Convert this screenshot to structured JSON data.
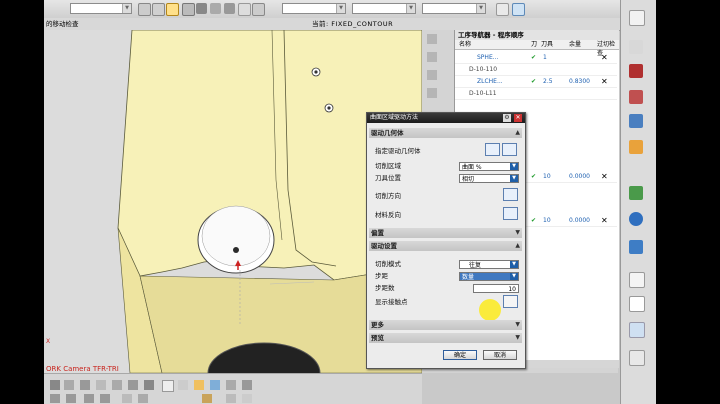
{
  "toolbar": {
    "combo1": "",
    "combo2": "",
    "combo3": "",
    "combo4": "",
    "mode_text": "当前: FIXED_CONTOUR",
    "left_title": "的移动检查"
  },
  "viewport": {
    "camera_label": "ORK Camera TFR-TRI",
    "axis_mark": "X"
  },
  "nav": {
    "title": "工序导航器 - 程序顺序",
    "columns": [
      "名称",
      "刀",
      "刀具",
      "余量",
      "过切检查"
    ],
    "rows": [
      {
        "name": "SPHE...",
        "tool": "1",
        "stock": ""
      },
      {
        "name": "D-10-110",
        "tool": "",
        "stock": ""
      },
      {
        "name": "ZLCHE...",
        "tool": "2.5",
        "stock": "0.8300"
      },
      {
        "name": "D-10-L11",
        "tool": "",
        "stock": ""
      },
      {
        "name": "",
        "tool": "10",
        "stock": "0.0000"
      },
      {
        "name": "",
        "tool": "10",
        "stock": "0.0000"
      }
    ]
  },
  "dialog": {
    "title": "曲面区域驱动方法",
    "sections": {
      "drive_geometry": "驱动几何体",
      "offset": "偏置",
      "drive_settings": "驱动设置",
      "more": "更多",
      "preview": "预览"
    },
    "fields": {
      "specify_drive": "指定驱动几何体",
      "cut_area": "切削区域",
      "cut_area_value": "曲面 %",
      "tool_position": "刀具位置",
      "tool_position_value": "相切",
      "cut_direction": "切削方向",
      "material_direction": "材料反向",
      "cut_pattern": "切削模式",
      "cut_pattern_value": "往复",
      "step_over": "步距",
      "step_over_value": "数量",
      "step_count": "步距数",
      "step_count_value": "10",
      "show_contact": "显示接触点"
    },
    "ok": "确定",
    "cancel": "取消"
  }
}
